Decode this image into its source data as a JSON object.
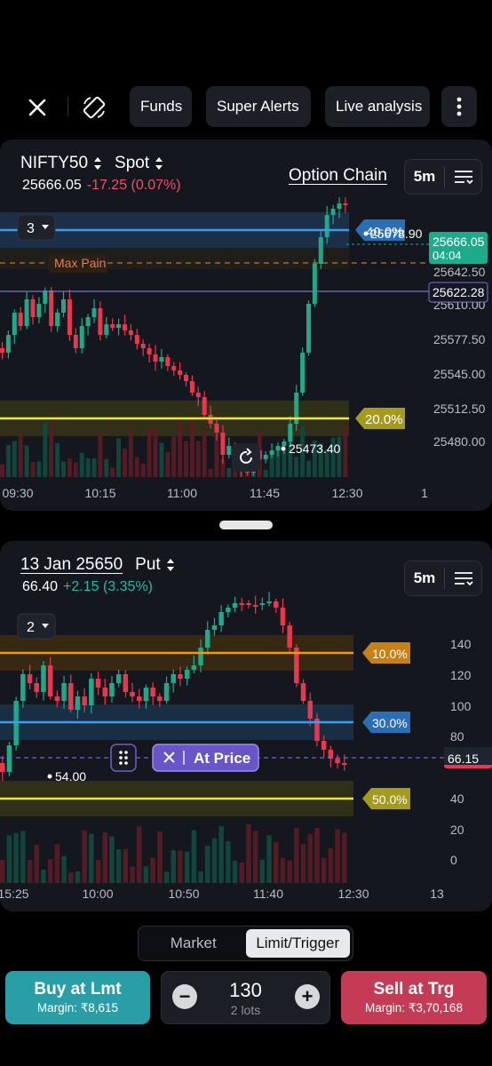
{
  "toolbar": {
    "pills": [
      "Funds",
      "Super Alerts",
      "Live analysis"
    ]
  },
  "chart1": {
    "symbol": "NIFTY50",
    "instrument": "Spot",
    "ltp": "25666.05",
    "change": "-17.25 (0.07%)",
    "option_chain_label": "Option Chain",
    "timeframe": "5m",
    "layer_badge": "3",
    "max_pain_label": "Max Pain",
    "level_blue_pct": "40.0%",
    "level_blue_value": "25678.90",
    "level_yellow_pct": "20.0%",
    "current_price_tag": "25666.05",
    "countdown": "04:04",
    "crosshair_value": "25622.28",
    "low_marker": "25473.40",
    "y_ticks": [
      "25642.50",
      "25610.00",
      "25577.50",
      "25545.00",
      "25512.50",
      "25480.00"
    ],
    "x_ticks": [
      "09:30",
      "10:15",
      "11:00",
      "11:45",
      "12:30",
      "1"
    ],
    "colors": {
      "up": "#1fa889",
      "down": "#e8384f",
      "blue_line": "#3d9bf0",
      "yellow_line": "#f2e63a",
      "price_tag": "#1faa8c"
    }
  },
  "chart2": {
    "title": "13 Jan 25650",
    "option_type": "Put",
    "ltp": "66.40",
    "change": "+2.15 (3.35%)",
    "timeframe": "5m",
    "layer_badge": "2",
    "level_orange_pct": "10.0%",
    "level_blue_pct": "30.0%",
    "level_yellow_pct": "50.0%",
    "at_price_label": "At Price",
    "current_price_tag": "66.15",
    "low_marker": "54.00",
    "y_ticks": [
      "140",
      "120",
      "100",
      "80",
      "40",
      "20",
      "0"
    ],
    "x_ticks": [
      "15:25",
      "10:00",
      "10:50",
      "11:40",
      "12:30",
      "13"
    ],
    "colors": {
      "orange_line": "#f29a17",
      "price_tag": "#e8384f",
      "at_price": "#7b61d9"
    }
  },
  "order": {
    "order_types": [
      "Market",
      "Limit/Trigger"
    ],
    "selected_type": "Limit/Trigger",
    "buy_label": "Buy at Lmt",
    "buy_margin": "Margin: ₹8,615",
    "quantity": "130",
    "lots": "2 lots",
    "sell_label": "Sell at Trg",
    "sell_margin": "Margin: ₹3,70,168"
  }
}
